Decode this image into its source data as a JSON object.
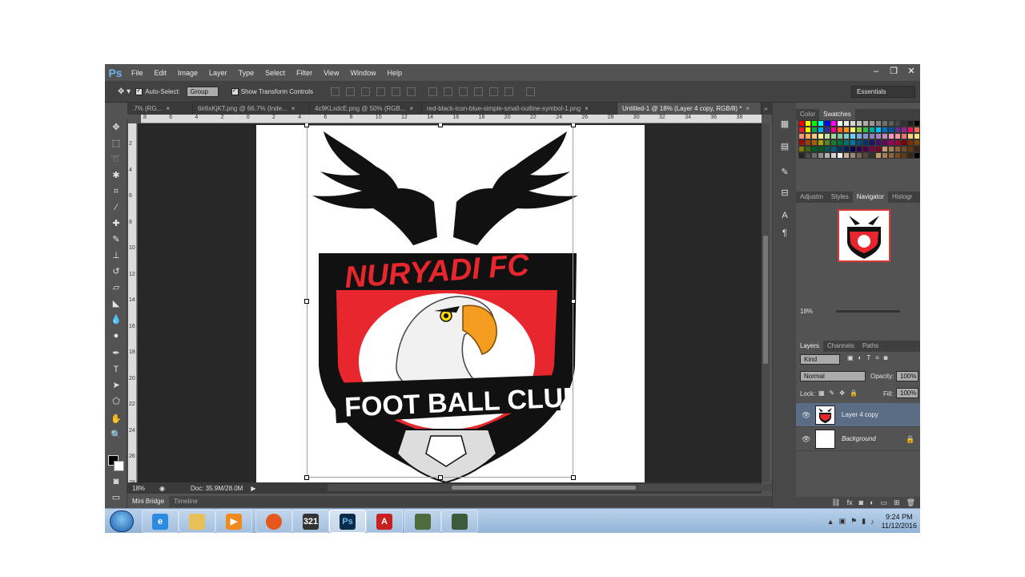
{
  "app": {
    "logo": "Ps"
  },
  "menu": [
    "File",
    "Edit",
    "Image",
    "Layer",
    "Type",
    "Select",
    "Filter",
    "View",
    "Window",
    "Help"
  ],
  "window_controls": {
    "minimize": "–",
    "restore": "❐",
    "close": "✕"
  },
  "options": {
    "tool_icon": "move-tool-icon",
    "auto_select_label": "Auto-Select:",
    "auto_select_checked": true,
    "auto_select_target": "Group",
    "transform_label": "Show Transform Controls",
    "transform_checked": true,
    "workspace": "Essentials"
  },
  "tabs": [
    {
      "label": ".7% (RG...",
      "close": "×",
      "active": false
    },
    {
      "label": "6ir6xKjKT.png @ 66.7% (Inde...",
      "close": "×",
      "active": false
    },
    {
      "label": "4c9KLxdcE.png @ 50% (RGB...",
      "close": "×",
      "active": false
    },
    {
      "label": "red-black-icon-blue-simple-small-outline-symbol-1.png",
      "close": "×",
      "active": false
    },
    {
      "label": "Untitled-1 @ 18% (Layer 4 copy, RGB/8) *",
      "close": "×",
      "active": true
    }
  ],
  "tab_overflow": "»",
  "ruler_h": [
    "8",
    "6",
    "4",
    "2",
    "0",
    "2",
    "4",
    "6",
    "8",
    "10",
    "12",
    "14",
    "16",
    "18",
    "20",
    "22",
    "24",
    "26",
    "28",
    "30",
    "32",
    "34",
    "36",
    "38"
  ],
  "ruler_v": [
    "2",
    "4",
    "6",
    "8",
    "10",
    "12",
    "14",
    "16",
    "18",
    "20",
    "22",
    "24",
    "26",
    "28"
  ],
  "logo": {
    "title": "NURYADI FC",
    "subtitle": "FOOT BALL CLUB"
  },
  "status": {
    "zoom": "18%",
    "doc_size": "Doc: 35.9M/28.0M"
  },
  "bottom_tabs": [
    "Mini Bridge",
    "Timeline"
  ],
  "panels": {
    "color_tabs": [
      "Color",
      "Swatches"
    ],
    "adjust_tabs": [
      "Adjustm",
      "Styles",
      "Navigator",
      "Histogr"
    ],
    "navigator_zoom": "18%",
    "layers_tabs": [
      "Layers",
      "Channels",
      "Paths"
    ],
    "kind_filter": "Kind",
    "blend_mode": "Normal",
    "opacity_label": "Opacity:",
    "opacity_value": "100%",
    "lock_label": "Lock:",
    "fill_label": "Fill:",
    "fill_value": "100%",
    "layers": [
      {
        "name": "Layer 4 copy",
        "selected": true
      },
      {
        "name": "Background",
        "selected": false,
        "locked": true
      }
    ]
  },
  "swatches": [
    "#ff0000",
    "#ffff00",
    "#00ff00",
    "#00ffff",
    "#0000ff",
    "#ff00ff",
    "#ffffff",
    "#ebebeb",
    "#d6d6d6",
    "#c2c2c2",
    "#adadad",
    "#999999",
    "#858585",
    "#707070",
    "#5c5c5c",
    "#474747",
    "#333333",
    "#1f1f1f",
    "#000000",
    "#ed1c24",
    "#fff200",
    "#00a651",
    "#00aeef",
    "#2e3192",
    "#ec008c",
    "#f26522",
    "#f7941d",
    "#fff568",
    "#8dc63f",
    "#39b54a",
    "#00a99d",
    "#00bff3",
    "#0072bc",
    "#0054a6",
    "#662d91",
    "#92278f",
    "#ed145b",
    "#f26c4f",
    "#f69679",
    "#fbaf5d",
    "#fdc689",
    "#fff799",
    "#c4df9b",
    "#a3d39c",
    "#82ca9c",
    "#7accc8",
    "#6dcff6",
    "#7da7d9",
    "#8393ca",
    "#8781bd",
    "#a186be",
    "#bd8cbf",
    "#f49ac1",
    "#f5989d",
    "#e57373",
    "#ffcc80",
    "#ffe082",
    "#9e0b0f",
    "#a0410d",
    "#a36209",
    "#aba000",
    "#598527",
    "#197b30",
    "#007236",
    "#00746b",
    "#0076a3",
    "#004b80",
    "#003471",
    "#1b1464",
    "#440e62",
    "#630460",
    "#9e005d",
    "#9e0039",
    "#790000",
    "#7b2e00",
    "#7d4900",
    "#827b00",
    "#406618",
    "#005e20",
    "#005826",
    "#005952",
    "#005b7f",
    "#003663",
    "#002157",
    "#0d004c",
    "#32004b",
    "#4b0049",
    "#7b0046",
    "#7a0026",
    "#c69c6d",
    "#a67c52",
    "#8c6239",
    "#754c24",
    "#603913",
    "#3c2415",
    "#252525",
    "#4a4a4a",
    "#6b6b6b",
    "#8d8d8d",
    "#b0b0b0",
    "#d2d2d2",
    "#f0f0f0",
    "#c7b299",
    "#998675",
    "#736357",
    "#534741",
    "#37302d",
    "#c69c6d",
    "#a67c52",
    "#8c6239",
    "#754c24",
    "#603913",
    "#3c2415",
    "#000000"
  ],
  "taskbar": {
    "time": "9:24 PM",
    "date": "11/12/2016",
    "apps": [
      "ie-icon",
      "explorer-icon",
      "media-player-icon",
      "firefox-icon",
      "video-editor-icon",
      "photoshop-icon",
      "acrobat-icon",
      "app-icon",
      "app-icon-2"
    ]
  },
  "colors": {
    "logo_red": "#e8262d",
    "logo_black": "#111111",
    "panel_bg": "#535353",
    "canvas_bg": "#282828"
  }
}
